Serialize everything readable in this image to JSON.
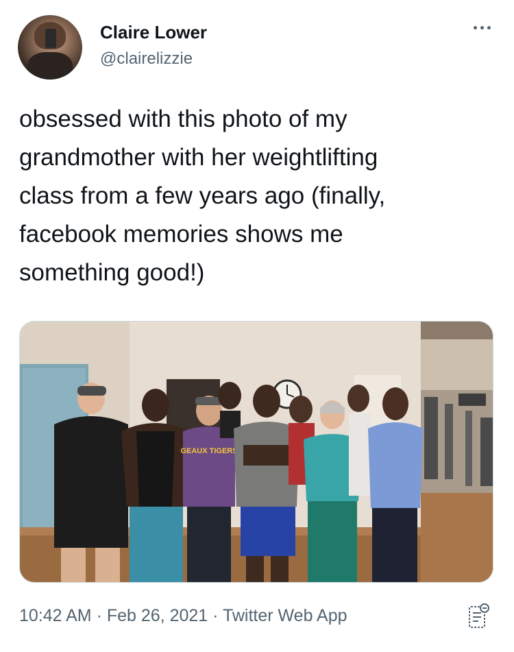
{
  "author": {
    "display_name": "Claire Lower",
    "handle": "@clairelizzie"
  },
  "tweet": {
    "lines": [
      "obsessed with this photo of my",
      "grandmother with her weightlifting",
      "class from a few years ago (finally,",
      "facebook memories shows me",
      "something good!)"
    ]
  },
  "media": {
    "shirt_text": "GEAUX TIGERS"
  },
  "meta": {
    "time": "10:42 AM",
    "separator": " · ",
    "date": "Feb 26, 2021",
    "app": "Twitter Web App"
  },
  "icons": {
    "more": "more-horizontal-icon",
    "analytics": "tweet-analytics-icon"
  },
  "colors": {
    "text_primary": "#0f1419",
    "text_secondary": "#536471",
    "media_border": "#cfd9de"
  }
}
